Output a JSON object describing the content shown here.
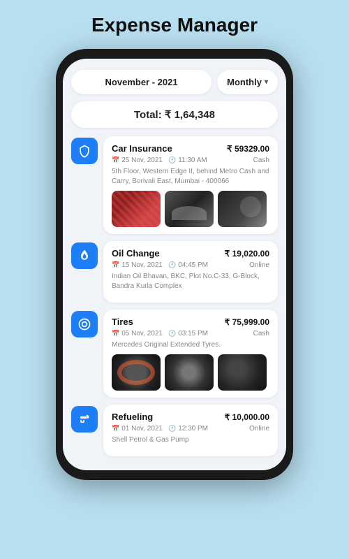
{
  "app": {
    "title": "Expense Manager"
  },
  "header": {
    "date": "November - 2021",
    "period": "Monthly",
    "total_label": "Total: ₹ 1,64,348"
  },
  "expenses": [
    {
      "id": "car-insurance",
      "icon": "shield",
      "name": "Car Insurance",
      "amount": "₹ 59329.00",
      "date": "25 Nov, 2021",
      "time": "11:30 AM",
      "payment": "Cash",
      "description": "5th Floor, Western Edge II, behind Metro Cash and Carry, Borivali East, Mumbai - 400066",
      "has_images": true,
      "image_type": "car"
    },
    {
      "id": "oil-change",
      "icon": "drop",
      "name": "Oil Change",
      "amount": "₹ 19,020.00",
      "date": "15 Nov, 2021",
      "time": "04:45 PM",
      "payment": "Online",
      "description": "Indian Oil Bhavan, BKC, Plot No.C-33, G-Block, Bandra Kurla Complex",
      "has_images": false,
      "image_type": null
    },
    {
      "id": "tires",
      "icon": "settings",
      "name": "Tires",
      "amount": "₹ 75,999.00",
      "date": "05 Nov, 2021",
      "time": "03:15 PM",
      "payment": "Cash",
      "description": "Mercedes Original Extended Tyres.",
      "has_images": true,
      "image_type": "tire"
    },
    {
      "id": "refueling",
      "icon": "fuel",
      "name": "Refueling",
      "amount": "₹ 10,000.00",
      "date": "01 Nov, 2021",
      "time": "12:30 PM",
      "payment": "Online",
      "description": "Shell Petrol & Gas Pump",
      "has_images": false,
      "image_type": null
    }
  ]
}
